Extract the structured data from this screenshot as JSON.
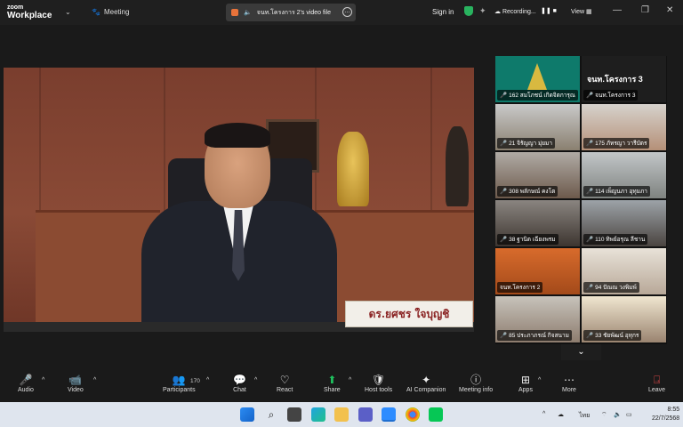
{
  "titlebar": {
    "brand_top": "zoom",
    "brand_bottom": "Workplace",
    "meeting": "Meeting",
    "share_tab": "จนท.โครงการ 2's video file",
    "signin": "Sign in",
    "recording": "Recording...",
    "view": "View"
  },
  "main_video": {
    "nameplate": "ดร.ยศชร ใจบุญชิ"
  },
  "gallery": {
    "big_name": "จนท.โครงการ 3",
    "tiles": [
      {
        "label": "162 สมโภชน์ เกิดจิตการุณ"
      },
      {
        "label": "จนท.โครงการ 3"
      },
      {
        "label": "21 จิรัญญา มุ่ยมา"
      },
      {
        "label": "175 ภัทรญา วารีบัตร"
      },
      {
        "label": "308 พลักษณ์ คงโต"
      },
      {
        "label": "114 เพ็ญนภา อุทุมภา"
      },
      {
        "label": "38 ฐานิต เฉียงพรม"
      },
      {
        "label": "110 ทิพย์อรุณ ลีชาน"
      },
      {
        "label": "จนท.โครงการ 2"
      },
      {
        "label": "94 ปัณณ วงพิมพ์"
      },
      {
        "label": "85 ประภาภรณ์ กิจสนาม"
      },
      {
        "label": "33 ชัยพัฒน์ อุทุกร"
      }
    ]
  },
  "toolbar": {
    "audio": "Audio",
    "video": "Video",
    "participants": "Participants",
    "participants_count": "170",
    "chat": "Chat",
    "react": "React",
    "share": "Share",
    "host_tools": "Host tools",
    "ai_companion": "AI Companion",
    "meeting_info": "Meeting info",
    "apps": "Apps",
    "more": "More",
    "leave": "Leave"
  },
  "taskbar": {
    "lang": "ไทย",
    "time": "8:55",
    "date": "22/7/2568"
  },
  "colors": {
    "accent_green": "#1fc15e",
    "mute_red": "#e04848",
    "active_speaker": "#2ed573"
  }
}
